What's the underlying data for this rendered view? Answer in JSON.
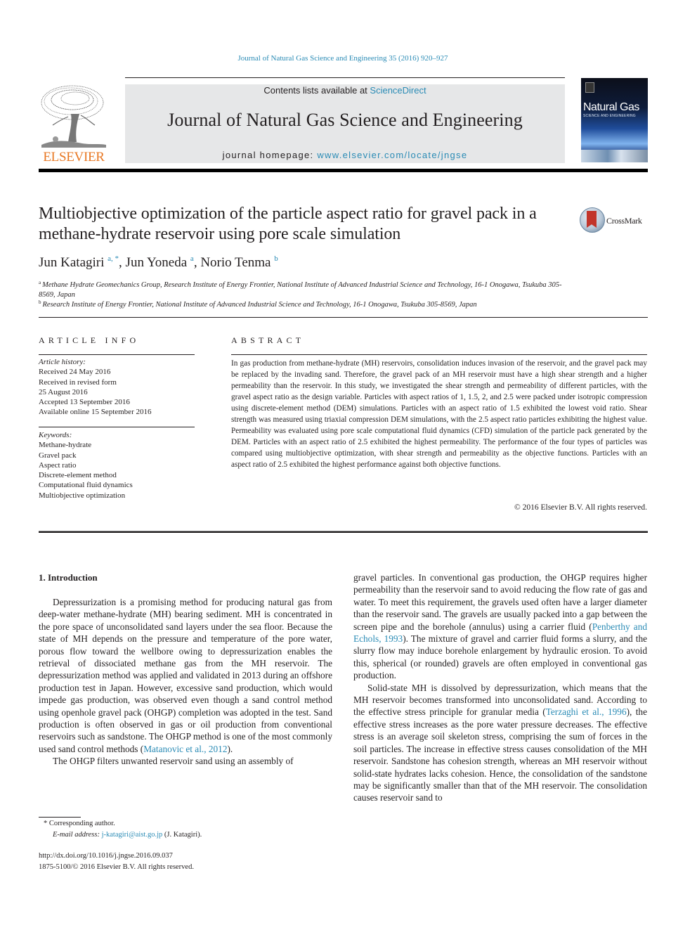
{
  "running_head": "Journal of Natural Gas Science and Engineering 35 (2016) 920–927",
  "publisher": {
    "name": "ELSEVIER",
    "logo_icon": "elsevier-tree-logo"
  },
  "masthead": {
    "contents_prefix": "Contents lists available at ",
    "contents_link": "ScienceDirect",
    "journal_title": "Journal of Natural Gas Science and Engineering",
    "homepage_prefix": "journal homepage: ",
    "homepage_link": "www.elsevier.com/locate/jngse"
  },
  "cover": {
    "title": "Natural Gas",
    "subtitle": "SCIENCE AND ENGINEERING"
  },
  "article": {
    "title": "Multiobjective optimization of the particle aspect ratio for gravel pack in a methane-hydrate reservoir using pore scale simulation",
    "crossmark_label": "CrossMark",
    "authors": [
      {
        "name": "Jun Katagiri",
        "sup": "a, *"
      },
      {
        "name": "Jun Yoneda",
        "sup": "a"
      },
      {
        "name": "Norio Tenma",
        "sup": "b"
      }
    ],
    "affiliations": [
      {
        "key": "a",
        "text": "Methane Hydrate Geomechanics Group, Research Institute of Energy Frontier, National Institute of Advanced Industrial Science and Technology, 16-1 Onogawa, Tsukuba 305-8569, Japan"
      },
      {
        "key": "b",
        "text": "Research Institute of Energy Frontier, National Institute of Advanced Industrial Science and Technology, 16-1 Onogawa, Tsukuba 305-8569, Japan"
      }
    ]
  },
  "article_info": {
    "heading": "ARTICLE INFO",
    "history_label": "Article history:",
    "history": [
      "Received 24 May 2016",
      "Received in revised form",
      "25 August 2016",
      "Accepted 13 September 2016",
      "Available online 15 September 2016"
    ],
    "keywords_label": "Keywords:",
    "keywords": [
      "Methane-hydrate",
      "Gravel pack",
      "Aspect ratio",
      "Discrete-element method",
      "Computational fluid dynamics",
      "Multiobjective optimization"
    ]
  },
  "abstract": {
    "heading": "ABSTRACT",
    "text": "In gas production from methane-hydrate (MH) reservoirs, consolidation induces invasion of the reservoir, and the gravel pack may be replaced by the invading sand. Therefore, the gravel pack of an MH reservoir must have a high shear strength and a higher permeability than the reservoir. In this study, we investigated the shear strength and permeability of different particles, with the gravel aspect ratio as the design variable. Particles with aspect ratios of 1, 1.5, 2, and 2.5 were packed under isotropic compression using discrete-element method (DEM) simulations. Particles with an aspect ratio of 1.5 exhibited the lowest void ratio. Shear strength was measured using triaxial compression DEM simulations, with the 2.5 aspect ratio particles exhibiting the highest value. Permeability was evaluated using pore scale computational fluid dynamics (CFD) simulation of the particle pack generated by the DEM. Particles with an aspect ratio of 2.5 exhibited the highest permeability. The performance of the four types of particles was compared using multiobjective optimization, with shear strength and permeability as the objective functions. Particles with an aspect ratio of 2.5 exhibited the highest performance against both objective functions.",
    "copyright": "© 2016 Elsevier B.V. All rights reserved."
  },
  "introduction": {
    "heading": "1.  Introduction",
    "p1": "Depressurization is a promising method for producing natural gas from deep-water methane-hydrate (MH) bearing sediment. MH is concentrated in the pore space of unconsolidated sand layers under the sea floor. Because the state of MH depends on the pressure and temperature of the pore water, porous flow toward the wellbore owing to depressurization enables the retrieval of dissociated methane gas from the MH reservoir. The depressurization method was applied and validated in 2013 during an offshore production test in Japan. However, excessive sand production, which would impede gas production, was observed even though a sand control method using openhole gravel pack (OHGP) completion was adopted in the test. Sand production is often observed in gas or oil production from conventional reservoirs such as sandstone. The OHGP method is one of the most commonly used sand control methods (",
    "p1_cite": "Matanovic et al., 2012",
    "p1_end": ").",
    "p2": "The OHGP filters unwanted reservoir sand using an assembly of",
    "p2_cont": "gravel particles. In conventional gas production, the OHGP requires higher permeability than the reservoir sand to avoid reducing the flow rate of gas and water. To meet this requirement, the gravels used often have a larger diameter than the reservoir sand. The gravels are usually packed into a gap between the screen pipe and the borehole (annulus) using a carrier fluid (",
    "p2_cite": "Penberthy and Echols, 1993",
    "p2_end": "). The mixture of gravel and carrier fluid forms a slurry, and the slurry flow may induce borehole enlargement by hydraulic erosion. To avoid this, spherical (or rounded) gravels are often employed in conventional gas production.",
    "p3_start": "Solid-state MH is dissolved by depressurization, which means that the MH reservoir becomes transformed into unconsolidated sand. According to the effective stress principle for granular media (",
    "p3_cite": "Terzaghi et al., 1996",
    "p3_end": "), the effective stress increases as the pore water pressure decreases. The effective stress is an average soil skeleton stress, comprising the sum of forces in the soil particles. The increase in effective stress causes consolidation of the MH reservoir. Sandstone has cohesion strength, whereas an MH reservoir without solid-state hydrates lacks cohesion. Hence, the consolidation of the sandstone may be significantly smaller than that of the MH reservoir. The consolidation causes reservoir sand to"
  },
  "footnotes": {
    "corresponding": "* Corresponding author.",
    "email_label": "E-mail address:",
    "email": "j-katagiri@aist.go.jp",
    "email_suffix": " (J. Katagiri).",
    "doi": "http://dx.doi.org/10.1016/j.jngse.2016.09.037",
    "issn": "1875-5100/© 2016 Elsevier B.V. All rights reserved."
  }
}
